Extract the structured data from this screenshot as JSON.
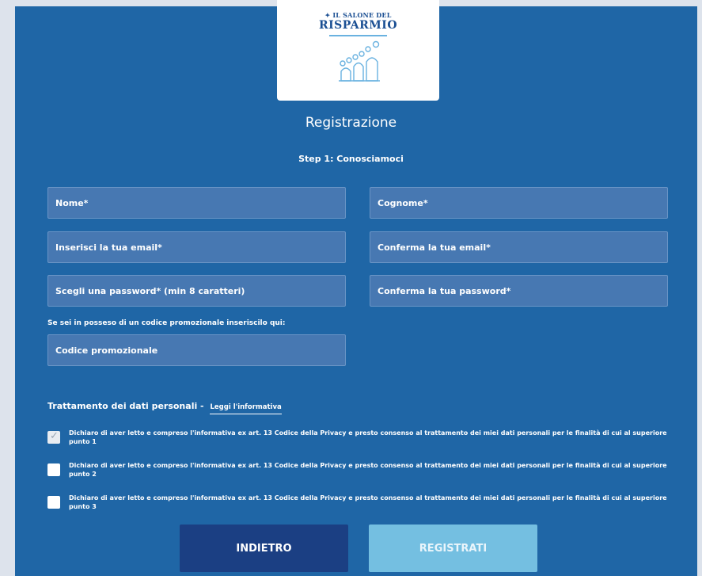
{
  "logo": {
    "top_text": "IL SALONE DEL",
    "main_text": "RISPARMIO"
  },
  "header": {
    "title": "Registrazione",
    "step": "Step 1: Conosciamoci"
  },
  "form": {
    "first_name": {
      "placeholder": "Nome*",
      "value": ""
    },
    "last_name": {
      "placeholder": "Cognome*",
      "value": ""
    },
    "email": {
      "placeholder": "Inserisci la tua email*",
      "value": ""
    },
    "email_confirm": {
      "placeholder": "Conferma la tua email*",
      "value": ""
    },
    "password": {
      "placeholder": "Scegli una password* (min 8 caratteri)",
      "value": ""
    },
    "password_confirm": {
      "placeholder": "Conferma la tua password*",
      "value": ""
    },
    "promo_label": "Se sei in posseso di un codice promozionale inseriscilo qui:",
    "promo": {
      "placeholder": "Codice promozionale",
      "value": ""
    }
  },
  "privacy": {
    "heading": "Trattamento dei dati personali -",
    "link_label": "Leggi l'informativa",
    "consents": [
      {
        "text": "Dichiaro di aver letto e compreso l'informativa ex art. 13 Codice della Privacy e presto consenso al trattamento dei miei dati personali per le finalità di cui al superiore punto 1",
        "checked": true
      },
      {
        "text": "Dichiaro di aver letto e compreso l'informativa ex art. 13 Codice della Privacy e presto consenso al trattamento dei miei dati personali per le finalità di cui al superiore punto 2",
        "checked": false
      },
      {
        "text": "Dichiaro di aver letto e compreso l'informativa ex art. 13 Codice della Privacy e presto consenso al trattamento dei miei dati personali per le finalità di cui al superiore punto 3",
        "checked": false
      }
    ]
  },
  "buttons": {
    "back": "INDIETRO",
    "register": "REGISTRATI"
  },
  "colors": {
    "background": "#1f66a6",
    "field": "#4778b2",
    "back_button": "#1b3f83",
    "register_button": "#74bfe1",
    "logo_blue": "#1b4f93"
  }
}
